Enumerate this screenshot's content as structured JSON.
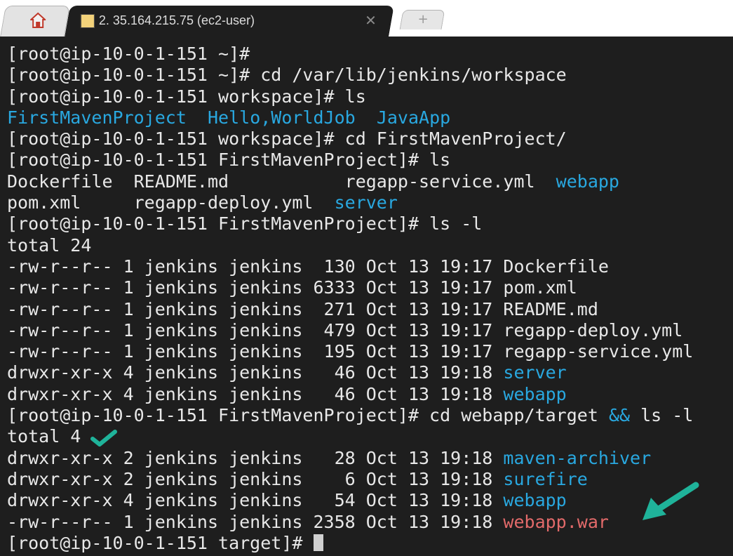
{
  "tabs": {
    "home_icon": "home-icon",
    "active_title": "2. 35.164.215.75 (ec2-user)",
    "close_glyph": "✕",
    "new_tab_glyph": "+"
  },
  "terminal": {
    "lines": [
      {
        "segments": [
          {
            "text": "[root@ip-10-0-1-151 ~]#"
          }
        ]
      },
      {
        "segments": [
          {
            "text": "[root@ip-10-0-1-151 ~]# cd /var/lib/jenkins/workspace"
          }
        ]
      },
      {
        "segments": [
          {
            "text": "[root@ip-10-0-1-151 workspace]# ls"
          }
        ]
      },
      {
        "segments": [
          {
            "text": "FirstMavenProject",
            "color": "dir"
          },
          {
            "text": "  "
          },
          {
            "text": "Hello,WorldJob",
            "color": "dir"
          },
          {
            "text": "  "
          },
          {
            "text": "JavaApp",
            "color": "dir"
          }
        ]
      },
      {
        "segments": [
          {
            "text": "[root@ip-10-0-1-151 workspace]# cd FirstMavenProject/"
          }
        ]
      },
      {
        "segments": [
          {
            "text": "[root@ip-10-0-1-151 FirstMavenProject]# ls"
          }
        ]
      },
      {
        "segments": [
          {
            "text": "Dockerfile  README.md           regapp-service.yml  "
          },
          {
            "text": "webapp",
            "color": "dir"
          }
        ]
      },
      {
        "segments": [
          {
            "text": "pom.xml     regapp-deploy.yml  "
          },
          {
            "text": "server",
            "color": "dir"
          }
        ]
      },
      {
        "segments": [
          {
            "text": "[root@ip-10-0-1-151 FirstMavenProject]# ls -l"
          }
        ]
      },
      {
        "segments": [
          {
            "text": "total 24"
          }
        ]
      },
      {
        "segments": [
          {
            "text": "-rw-r--r-- 1 jenkins jenkins  130 Oct 13 19:17 Dockerfile"
          }
        ]
      },
      {
        "segments": [
          {
            "text": "-rw-r--r-- 1 jenkins jenkins 6333 Oct 13 19:17 pom.xml"
          }
        ]
      },
      {
        "segments": [
          {
            "text": "-rw-r--r-- 1 jenkins jenkins  271 Oct 13 19:17 README.md"
          }
        ]
      },
      {
        "segments": [
          {
            "text": "-rw-r--r-- 1 jenkins jenkins  479 Oct 13 19:17 regapp-deploy.yml"
          }
        ]
      },
      {
        "segments": [
          {
            "text": "-rw-r--r-- 1 jenkins jenkins  195 Oct 13 19:17 regapp-service.yml"
          }
        ]
      },
      {
        "segments": [
          {
            "text": "drwxr-xr-x 4 jenkins jenkins   46 Oct 13 19:18 "
          },
          {
            "text": "server",
            "color": "dir"
          }
        ]
      },
      {
        "segments": [
          {
            "text": "drwxr-xr-x 4 jenkins jenkins   46 Oct 13 19:18 "
          },
          {
            "text": "webapp",
            "color": "dir"
          }
        ]
      },
      {
        "segments": [
          {
            "text": "[root@ip-10-0-1-151 FirstMavenProject]# cd webapp/target "
          },
          {
            "text": "&&",
            "color": "op"
          },
          {
            "text": " ls -l"
          }
        ]
      },
      {
        "segments": [
          {
            "text": "total 4"
          }
        ]
      },
      {
        "segments": [
          {
            "text": "drwxr-xr-x 2 jenkins jenkins   28 Oct 13 19:18 "
          },
          {
            "text": "maven-archiver",
            "color": "dir"
          }
        ]
      },
      {
        "segments": [
          {
            "text": "drwxr-xr-x 2 jenkins jenkins    6 Oct 13 19:18 "
          },
          {
            "text": "surefire",
            "color": "dir"
          }
        ]
      },
      {
        "segments": [
          {
            "text": "drwxr-xr-x 4 jenkins jenkins   54 Oct 13 19:18 "
          },
          {
            "text": "webapp",
            "color": "dir"
          }
        ]
      },
      {
        "segments": [
          {
            "text": "-rw-r--r-- 1 jenkins jenkins 2358 Oct 13 19:18 "
          },
          {
            "text": "webapp.war",
            "color": "war"
          }
        ]
      },
      {
        "segments": [
          {
            "text": "[root@ip-10-0-1-151 target]# "
          }
        ],
        "cursor": true
      }
    ]
  },
  "annotations": {
    "check_icon": "checkmark-icon",
    "arrow_icon": "arrow-icon",
    "accent_color": "#1fb39a"
  },
  "colors": {
    "background": "#1e1e1e",
    "text": "#e8e8e8",
    "dir": "#29a8e0",
    "war": "#e26a6a"
  }
}
